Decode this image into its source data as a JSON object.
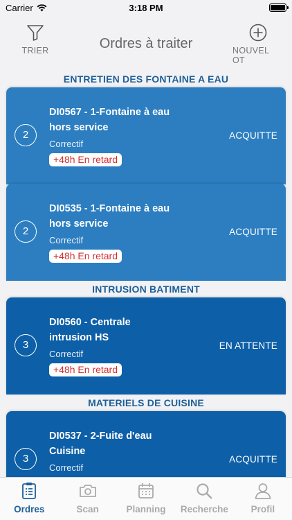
{
  "status_bar": {
    "carrier": "Carrier",
    "time": "3:18 PM"
  },
  "header": {
    "title": "Ordres à traiter",
    "sort_label": "TRIER",
    "new_label": "NOUVEL OT"
  },
  "sections": [
    {
      "title": "ENTRETIEN DES FONTAINE A EAU",
      "items": [
        {
          "count": "2",
          "title": "DI0567 - 1-Fontaine à eau hors service",
          "type": "Correctif",
          "late": "+48h En retard",
          "status": "ACQUITTE"
        },
        {
          "count": "2",
          "title": "DI0535 - 1-Fontaine à eau hors service",
          "type": "Correctif",
          "late": "+48h En retard",
          "status": "ACQUITTE"
        }
      ]
    },
    {
      "title": "INTRUSION BATIMENT",
      "items": [
        {
          "count": "3",
          "title": "DI0560 - Centrale intrusion HS",
          "type": "Correctif",
          "late": "+48h En retard",
          "status": "EN ATTENTE"
        }
      ]
    },
    {
      "title": "MATERIELS DE CUISINE",
      "items": [
        {
          "count": "3",
          "title": "DI0537 - 2-Fuite d'eau Cuisine",
          "type": "Correctif",
          "late": "",
          "status": "ACQUITTE"
        }
      ]
    }
  ],
  "tabs": [
    {
      "label": "Ordres",
      "icon": "clipboard-icon"
    },
    {
      "label": "Scan",
      "icon": "camera-icon"
    },
    {
      "label": "Planning",
      "icon": "calendar-icon"
    },
    {
      "label": "Recherche",
      "icon": "search-icon"
    },
    {
      "label": "Profil",
      "icon": "person-icon"
    }
  ],
  "colors": {
    "accent": "#1d5f98",
    "card_light": "#2c7ec0",
    "card_dark": "#0d5fa7",
    "late_text": "#d32f2f"
  }
}
